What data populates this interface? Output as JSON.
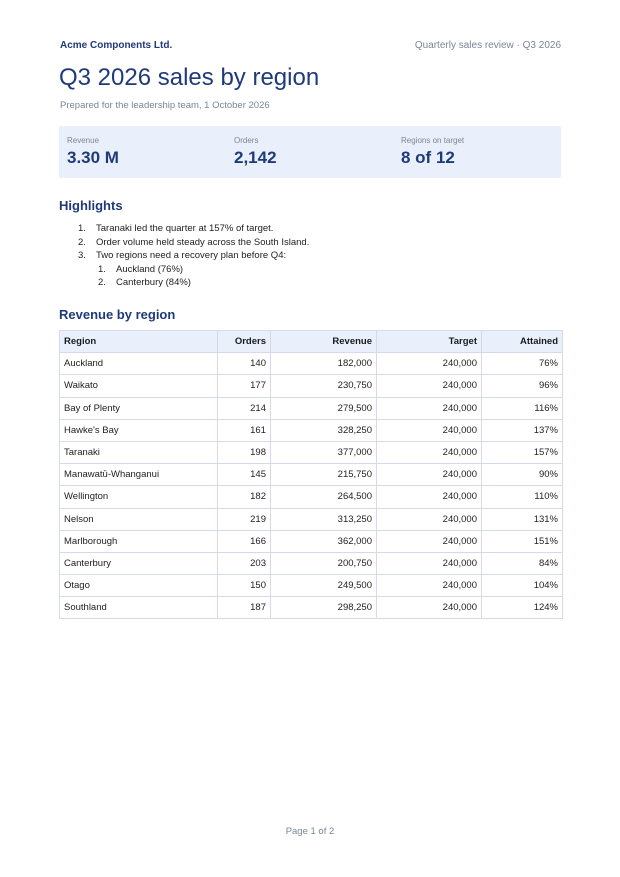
{
  "header": {
    "brand": "Acme Components Ltd.",
    "doc_label": "Quarterly sales review · Q3 2026"
  },
  "title": "Q3 2026 sales by region",
  "subtitle": "Prepared for the leadership team, 1 October 2026",
  "kpis": [
    {
      "label": "Revenue",
      "value": "3.30 M"
    },
    {
      "label": "Orders",
      "value": "2,142"
    },
    {
      "label": "Regions on target",
      "value": "8 of 12"
    }
  ],
  "highlights": {
    "heading": "Highlights",
    "items": [
      {
        "num": "1.",
        "text": "Taranaki led the quarter at 157% of target."
      },
      {
        "num": "2.",
        "text": "Order volume held steady across the South Island."
      },
      {
        "num": "3.",
        "text": "Two regions need a recovery plan before Q4:"
      }
    ],
    "subitems": [
      {
        "num": "1.",
        "text": "Auckland (76%)"
      },
      {
        "num": "2.",
        "text": "Canterbury (84%)"
      }
    ]
  },
  "revenue_section": {
    "heading": "Revenue by region",
    "columns": [
      "Region",
      "Orders",
      "Revenue",
      "Target",
      "Attained"
    ],
    "rows": [
      {
        "region": "Auckland",
        "orders": "140",
        "revenue": "182,000",
        "target": "240,000",
        "attained": "76%",
        "status": "under"
      },
      {
        "region": "Waikato",
        "orders": "177",
        "revenue": "230,750",
        "target": "240,000",
        "attained": "96%",
        "status": "under"
      },
      {
        "region": "Bay of Plenty",
        "orders": "214",
        "revenue": "279,500",
        "target": "240,000",
        "attained": "116%",
        "status": "over"
      },
      {
        "region": "Hawke's Bay",
        "orders": "161",
        "revenue": "328,250",
        "target": "240,000",
        "attained": "137%",
        "status": "over"
      },
      {
        "region": "Taranaki",
        "orders": "198",
        "revenue": "377,000",
        "target": "240,000",
        "attained": "157%",
        "status": "over"
      },
      {
        "region": "Manawatū-Whanganui",
        "orders": "145",
        "revenue": "215,750",
        "target": "240,000",
        "attained": "90%",
        "status": "under"
      },
      {
        "region": "Wellington",
        "orders": "182",
        "revenue": "264,500",
        "target": "240,000",
        "attained": "110%",
        "status": "over"
      },
      {
        "region": "Nelson",
        "orders": "219",
        "revenue": "313,250",
        "target": "240,000",
        "attained": "131%",
        "status": "over"
      },
      {
        "region": "Marlborough",
        "orders": "166",
        "revenue": "362,000",
        "target": "240,000",
        "attained": "151%",
        "status": "over"
      },
      {
        "region": "Canterbury",
        "orders": "203",
        "revenue": "200,750",
        "target": "240,000",
        "attained": "84%",
        "status": "under"
      },
      {
        "region": "Otago",
        "orders": "150",
        "revenue": "249,500",
        "target": "240,000",
        "attained": "104%",
        "status": "over"
      },
      {
        "region": "Southland",
        "orders": "187",
        "revenue": "298,250",
        "target": "240,000",
        "attained": "124%",
        "status": "over"
      }
    ]
  },
  "colors": {
    "accent": "#1f3a7a",
    "under": "#b3262d",
    "over": "#2a8a3a",
    "panel": "#eaf0fb"
  },
  "footer": "Page 1 of 2"
}
